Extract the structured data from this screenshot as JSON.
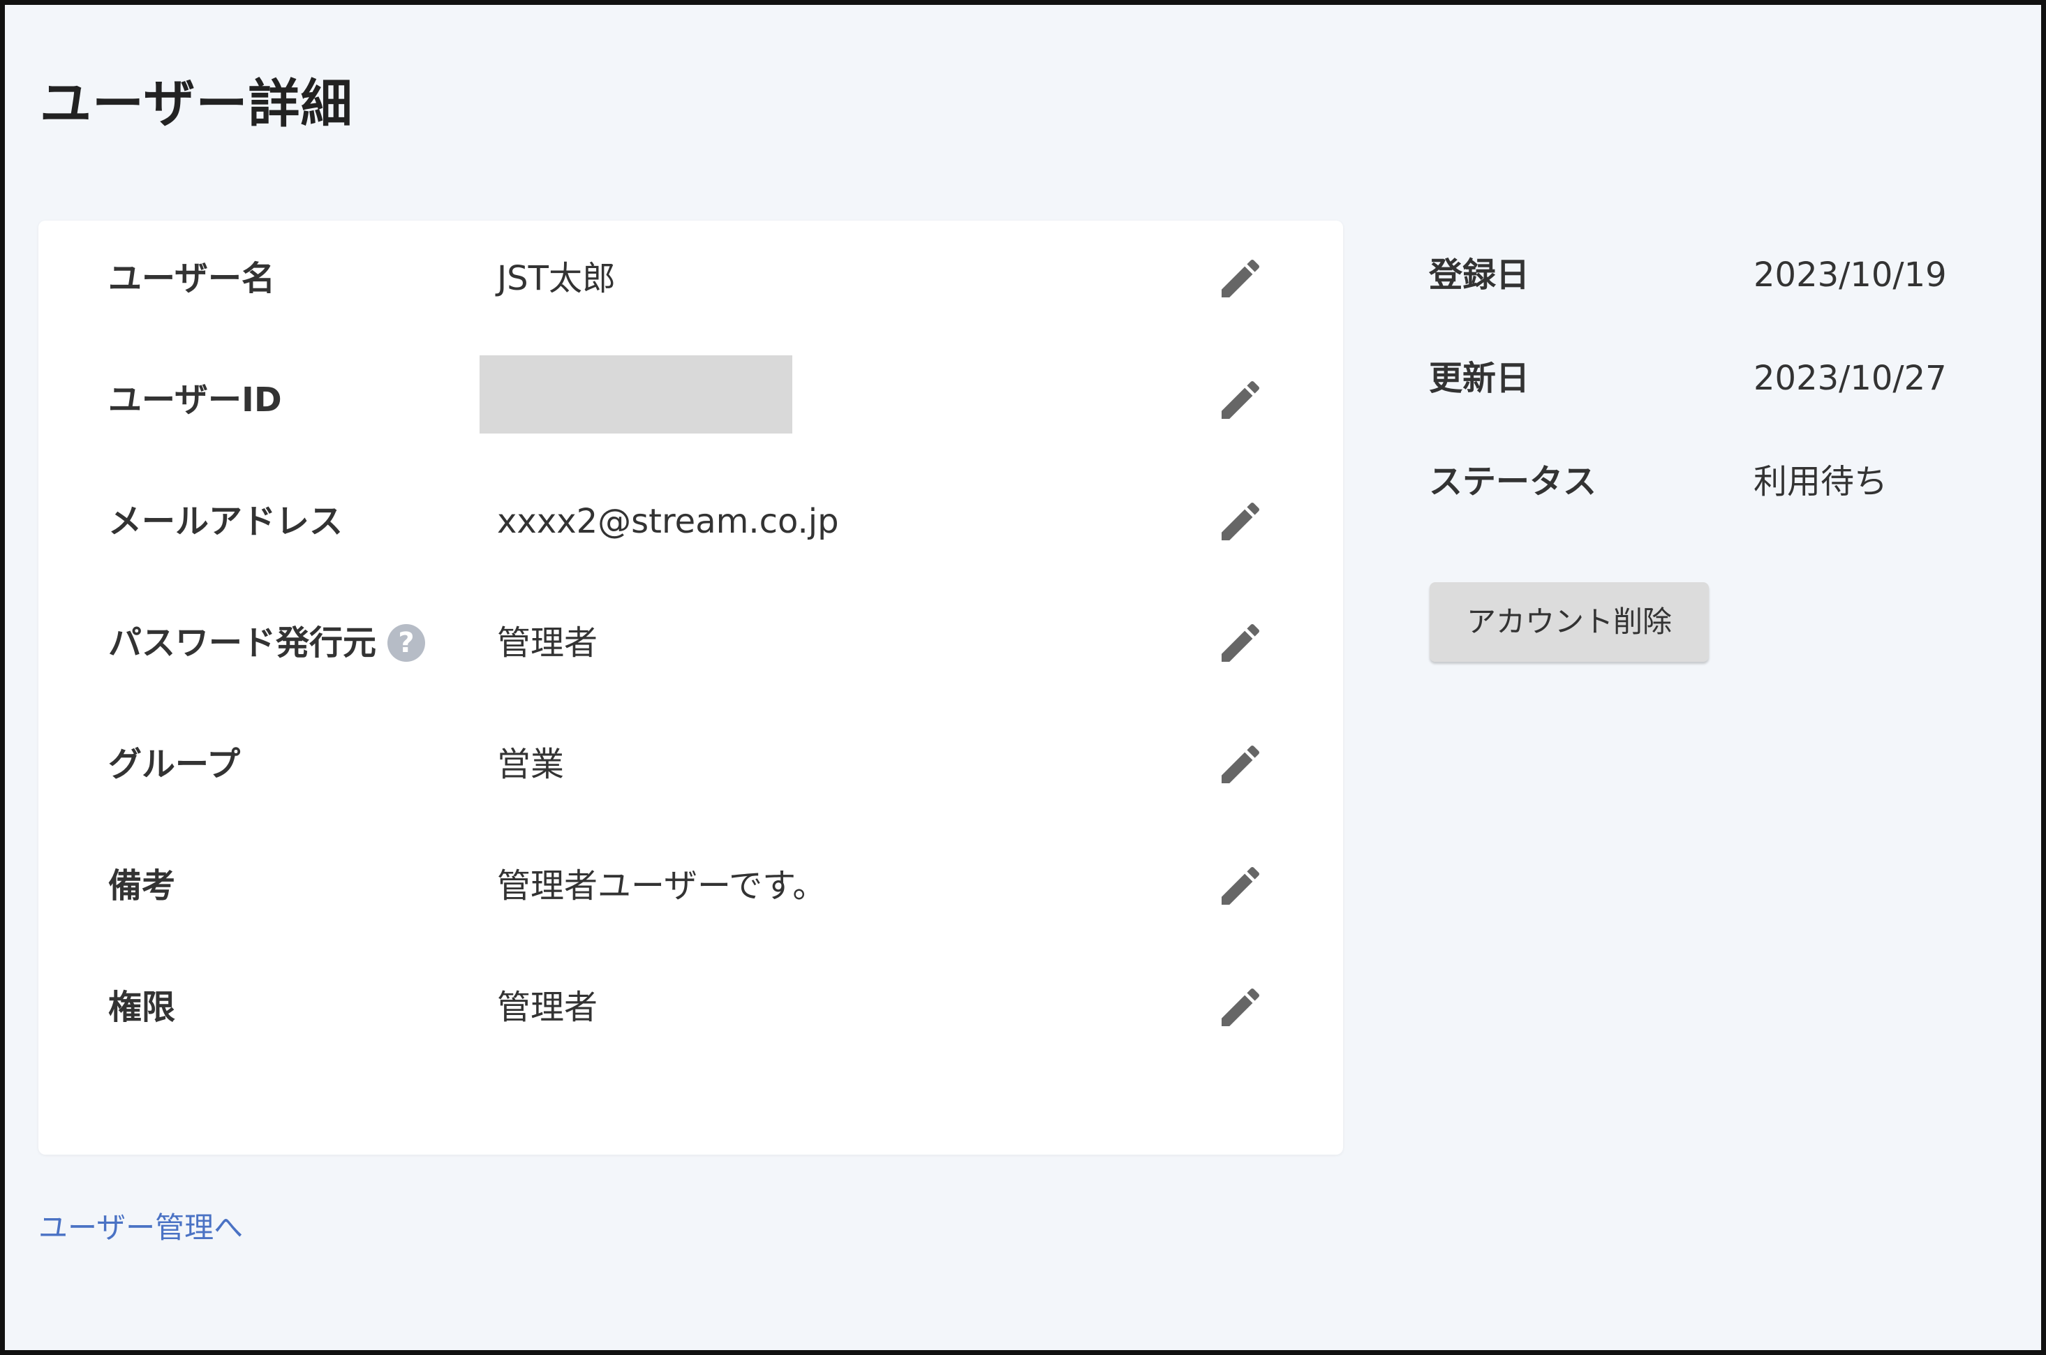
{
  "page_title": "ユーザー詳細",
  "fields": [
    {
      "label": "ユーザー名",
      "value": "JST太郎"
    },
    {
      "label": "ユーザーID",
      "value": ""
    },
    {
      "label": "メールアドレス",
      "value": "xxxx2@stream.co.jp"
    },
    {
      "label": "パスワード発行元",
      "value": "管理者",
      "help": "?"
    },
    {
      "label": "グループ",
      "value": "営業"
    },
    {
      "label": "備考",
      "value": "管理者ユーザーです。"
    },
    {
      "label": "権限",
      "value": "管理者"
    }
  ],
  "side": {
    "registered_label": "登録日",
    "registered_value": "2023/10/19",
    "updated_label": "更新日",
    "updated_value": "2023/10/27",
    "status_label": "ステータス",
    "status_value": "利用待ち",
    "delete_button": "アカウント削除"
  },
  "back_link": "ユーザー管理へ",
  "icons": {
    "edit": "pencil-icon",
    "help": "question-circle-icon"
  },
  "colors": {
    "background": "#f3f6fa",
    "card": "#ffffff",
    "link": "#4a72c4",
    "icon": "#666666",
    "button": "#dcdcdc",
    "redacted": "#d9d9d9"
  }
}
